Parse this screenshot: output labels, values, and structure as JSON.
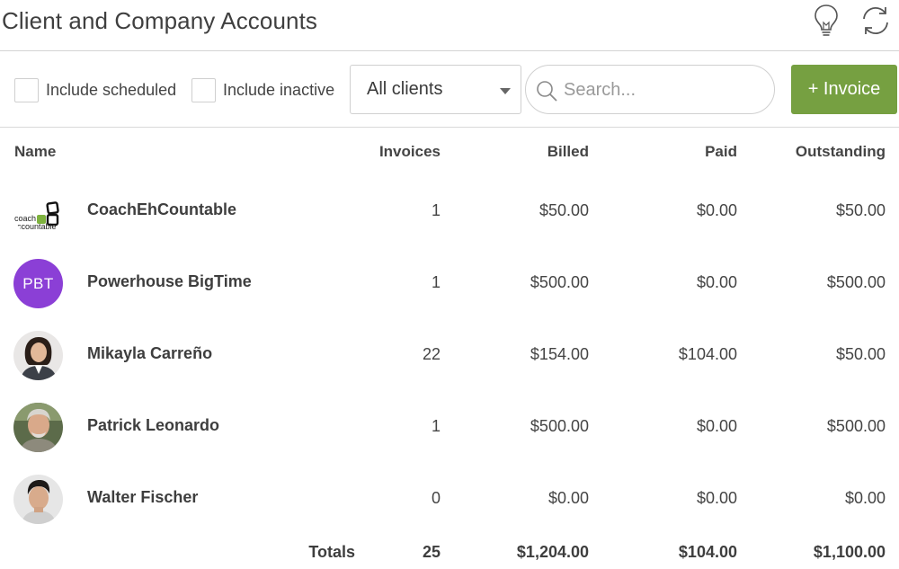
{
  "header": {
    "title": "Client and Company Accounts",
    "icons": [
      "lightbulb-icon",
      "refresh-icon"
    ]
  },
  "toolbar": {
    "include_scheduled_label": "Include scheduled",
    "include_scheduled_checked": false,
    "include_inactive_label": "Include inactive",
    "include_inactive_checked": false,
    "client_filter_value": "All clients",
    "search_placeholder": "Search...",
    "search_value": "",
    "invoice_button_label": "+ Invoice"
  },
  "colors": {
    "invoice_button": "#76a041",
    "pbt_avatar": "#8b3fd6"
  },
  "table": {
    "columns": {
      "name": "Name",
      "invoices": "Invoices",
      "billed": "Billed",
      "paid": "Paid",
      "outstanding": "Outstanding"
    },
    "rows": [
      {
        "name": "CoachEhCountable",
        "avatar": "coach-accountable-logo",
        "avatar_text_1": "coach",
        "avatar_text_2": "accountable",
        "invoices": "1",
        "billed": "$50.00",
        "paid": "$0.00",
        "outstanding": "$50.00"
      },
      {
        "name": "Powerhouse BigTime",
        "avatar": "initials",
        "avatar_text": "PBT",
        "invoices": "1",
        "billed": "$500.00",
        "paid": "$0.00",
        "outstanding": "$500.00"
      },
      {
        "name": "Mikayla Carreño",
        "avatar": "photo-woman",
        "invoices": "22",
        "billed": "$154.00",
        "paid": "$104.00",
        "outstanding": "$50.00"
      },
      {
        "name": "Patrick Leonardo",
        "avatar": "photo-older-man",
        "invoices": "1",
        "billed": "$500.00",
        "paid": "$0.00",
        "outstanding": "$500.00"
      },
      {
        "name": "Walter Fischer",
        "avatar": "photo-man",
        "invoices": "0",
        "billed": "$0.00",
        "paid": "$0.00",
        "outstanding": "$0.00"
      }
    ],
    "totals": {
      "label": "Totals",
      "invoices": "25",
      "billed": "$1,204.00",
      "paid": "$104.00",
      "outstanding": "$1,100.00"
    }
  }
}
